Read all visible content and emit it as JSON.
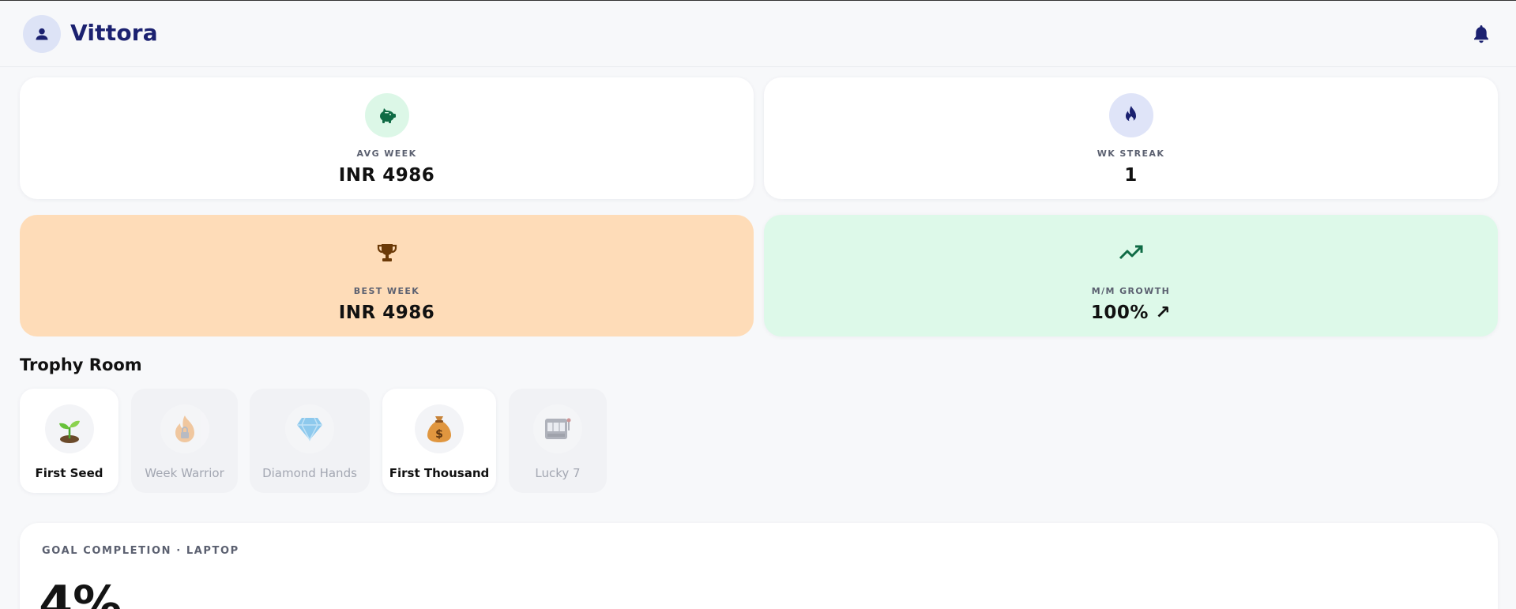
{
  "header": {
    "brand": "Vittora",
    "icons": {
      "avatar": "user-icon",
      "notifications": "bell-icon"
    }
  },
  "stats": [
    {
      "id": "avg",
      "icon": "piggy-bank-icon",
      "label": "AVG WEEK",
      "value": "INR 4986"
    },
    {
      "id": "streak",
      "icon": "flame-icon",
      "label": "WK STREAK",
      "value": "1"
    },
    {
      "id": "best",
      "icon": "trophy-icon",
      "label": "BEST WEEK",
      "value": "INR 4986"
    },
    {
      "id": "growth",
      "icon": "trending-up-icon",
      "label": "M/M GROWTH",
      "value": "100% ↗"
    }
  ],
  "trophy_room": {
    "title": "Trophy Room",
    "items": [
      {
        "label": "First Seed",
        "icon": "seedling-icon",
        "unlocked": true
      },
      {
        "label": "Week Warrior",
        "icon": "flame-locked-icon",
        "unlocked": false
      },
      {
        "label": "Diamond Hands",
        "icon": "diamond-icon",
        "unlocked": false
      },
      {
        "label": "First Thousand",
        "icon": "money-bag-icon",
        "unlocked": true
      },
      {
        "label": "Lucky 7",
        "icon": "slot-machine-icon",
        "unlocked": false
      }
    ]
  },
  "goal": {
    "label": "GOAL COMPLETION · LAPTOP",
    "percent": "4%"
  },
  "colors": {
    "brand": "#1b2170",
    "avg_card": "#ffffff",
    "best_card": "#fedcb8",
    "growth_card": "#ddf9e9",
    "piggy_icon_bg": "#dcf7e7",
    "streak_icon_bg": "#dfe4f8"
  }
}
